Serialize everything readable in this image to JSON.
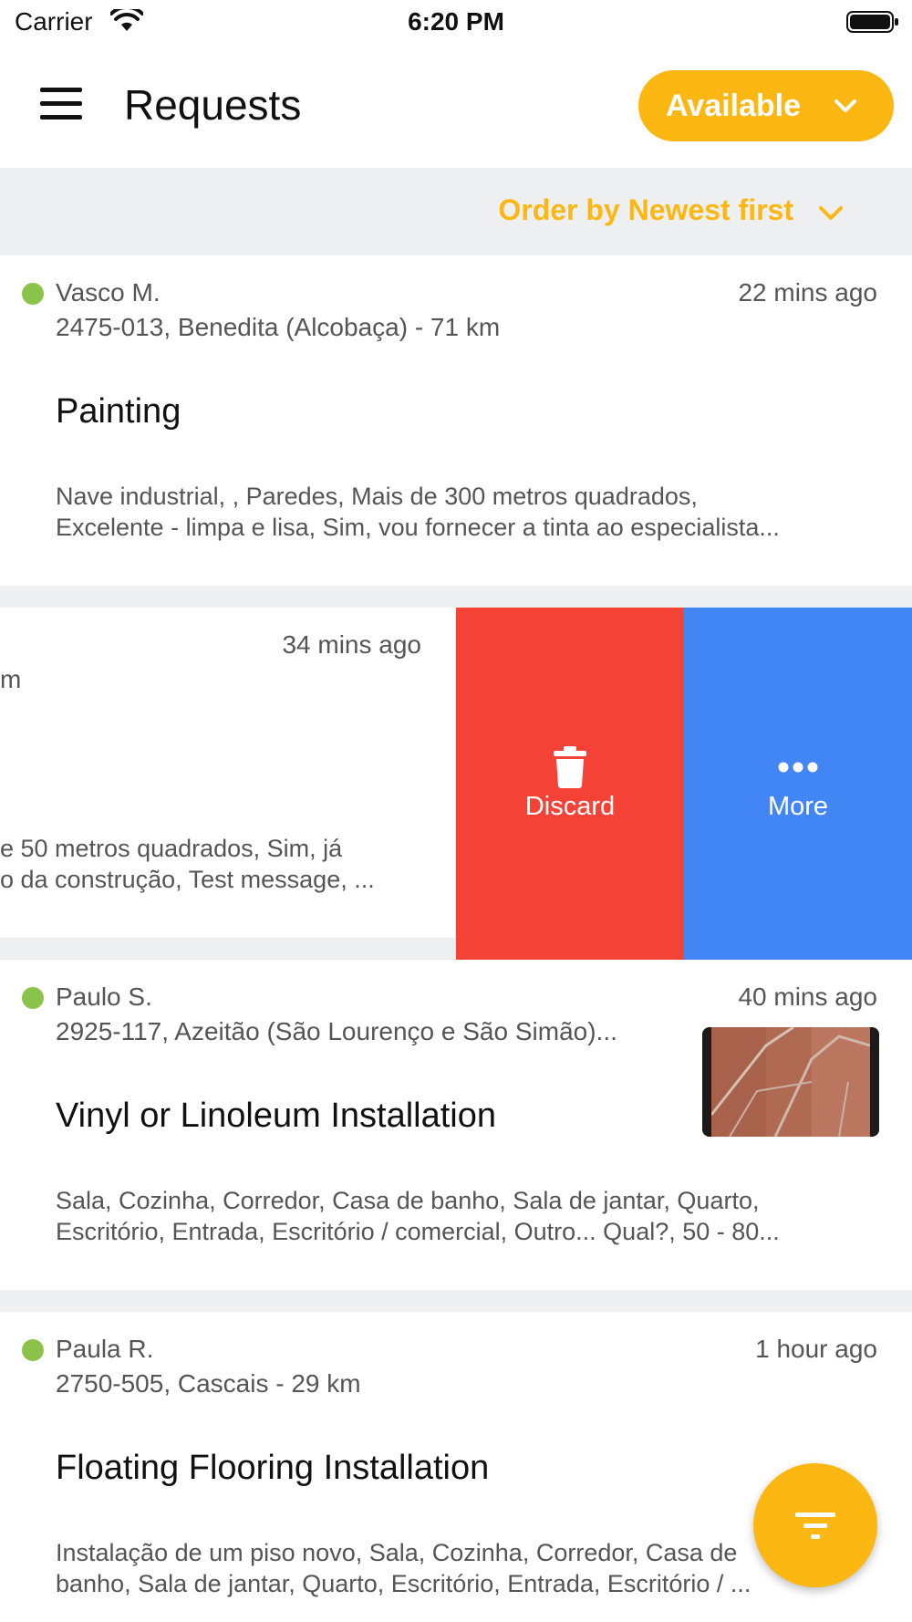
{
  "status_bar": {
    "carrier": "Carrier",
    "time": "6:20 PM"
  },
  "header": {
    "title": "Requests",
    "availability": "Available"
  },
  "sort": {
    "label": "Order by Newest first"
  },
  "requests": [
    {
      "name": "Vasco M.",
      "time": "22 mins ago",
      "location": "2475-013, Benedita (Alcobaça) - 71 km",
      "service": "Painting",
      "description_line1": "Nave industrial, , Paredes, Mais de 300 metros quadrados,",
      "description_line2": "Excelente - limpa e lisa, Sim, vou fornecer a tinta ao especialista..."
    },
    {
      "time": "34 mins ago",
      "location_fragment": "m",
      "description_line1": "e 50 metros quadrados, Sim, já",
      "description_line2": "o da construção, Test message, ..."
    },
    {
      "name": "Paulo S.",
      "time": "40 mins ago",
      "location": "2925-117, Azeitão (São Lourenço e São Simão)...",
      "service": "Vinyl or Linoleum Installation",
      "description_line1": "Sala, Cozinha, Corredor, Casa de banho, Sala de jantar, Quarto,",
      "description_line2": "Escritório, Entrada, Escritório / comercial, Outro... Qual?, 50 - 80..."
    },
    {
      "name": "Paula R.",
      "time": "1 hour ago",
      "location": "2750-505, Cascais - 29 km",
      "service": "Floating Flooring Installation",
      "description_line1": "Instalação de um piso novo, Sala, Cozinha, Corredor, Casa de",
      "description_line2": "banho, Sala de jantar, Quarto, Escritório, Entrada, Escritório / ..."
    }
  ],
  "swipe_actions": {
    "discard": "Discard",
    "more": "More"
  },
  "colors": {
    "accent": "#fdb713",
    "discard": "#f44336",
    "more": "#4285f4",
    "online_dot": "#8bc34a"
  },
  "icons": {
    "menu": "hamburger-icon",
    "chevron": "chevron-down-icon",
    "discard": "trash-icon",
    "more": "more-dots-icon",
    "fab": "filter-icon"
  }
}
